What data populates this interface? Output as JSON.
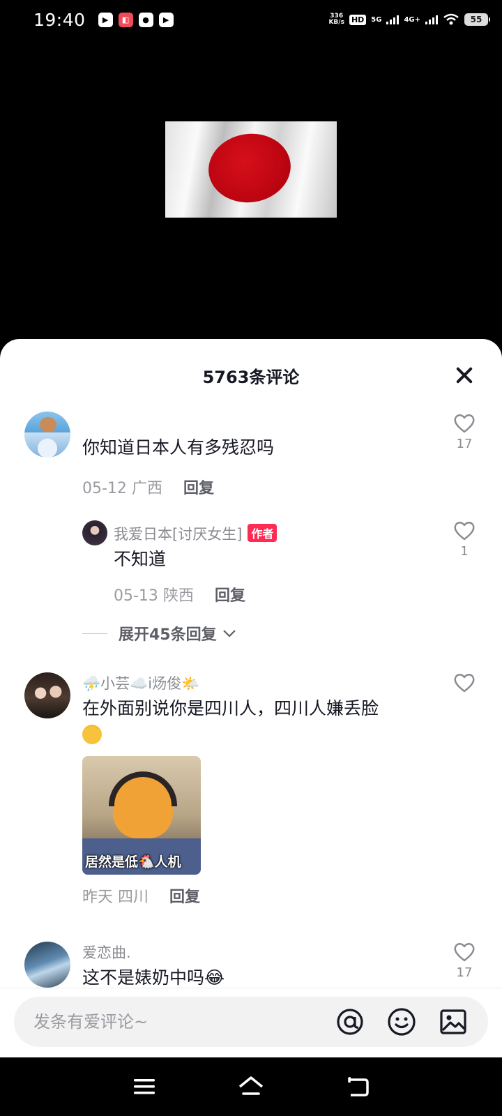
{
  "status_bar": {
    "time": "19:40",
    "net_speed_value": "336",
    "net_speed_unit": "KB/s",
    "hd": "HD",
    "hd_sub": "1 2",
    "sig1": "5G",
    "sig2": "4G+",
    "battery": "55",
    "app_icons": [
      "video-icon",
      "photo-icon",
      "wechat-icon",
      "play-icon"
    ]
  },
  "sheet": {
    "title": "5763条评论",
    "close_icon": "close-icon"
  },
  "comments": [
    {
      "text": "你知道日本人有多残忍吗",
      "date": "05-12",
      "location": "广西",
      "reply_label": "回复",
      "likes": "17"
    },
    {
      "username": "我爱日本[讨厌女生]",
      "author_badge": "作者",
      "text": "不知道",
      "date": "05-13",
      "location": "陕西",
      "reply_label": "回复",
      "likes": "1"
    },
    {
      "expand_label": "展开45条回复"
    },
    {
      "username": "⛈️小芸☁️i炀俊🌤️",
      "text": "在外面别说你是四川人，四川人嫌丢脸",
      "sticker_caption": "居然是低🐔人机",
      "date": "昨天",
      "location": "四川",
      "reply_label": "回复"
    },
    {
      "username": "爱恋曲.",
      "text": "这不是婊奶中吗😂",
      "likes": "17"
    }
  ],
  "input_bar": {
    "placeholder": "发条有爱评论~",
    "icons": [
      "at-icon",
      "emoji-icon",
      "image-icon"
    ]
  },
  "nav_bar": {
    "icons": [
      "menu-icon",
      "home-icon",
      "back-icon"
    ]
  }
}
